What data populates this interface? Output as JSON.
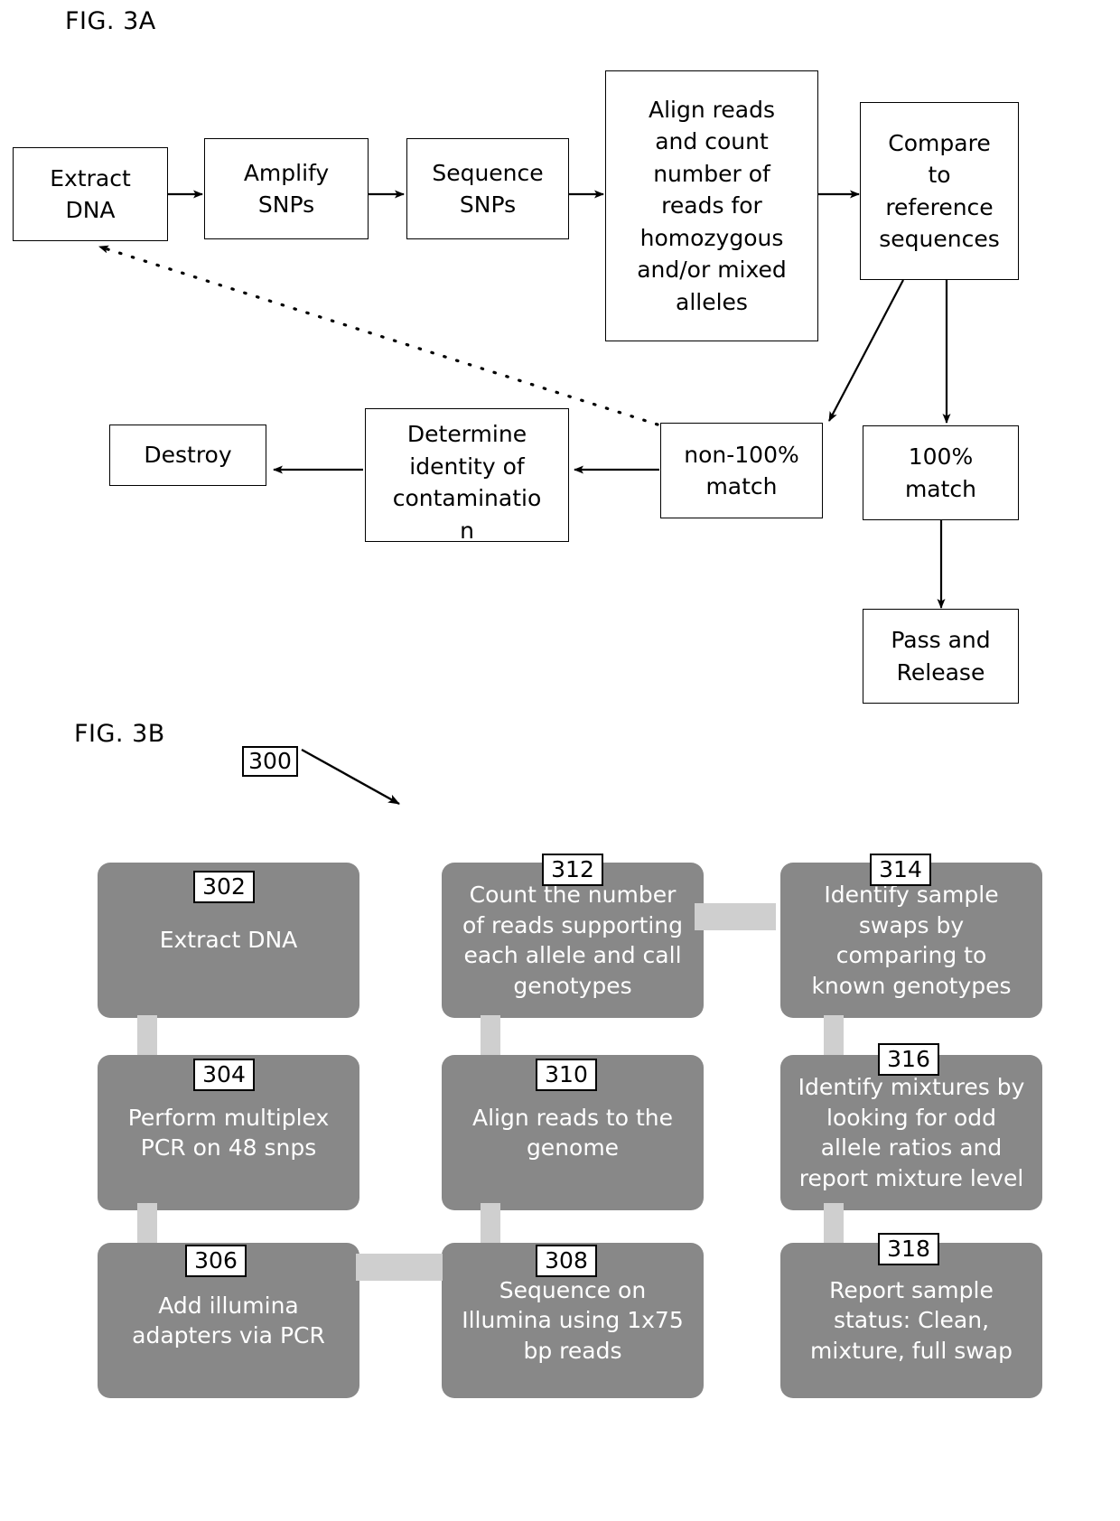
{
  "figures": {
    "fig_a": {
      "caption": "FIG. 3A",
      "boxes": [
        {
          "id": "extract-dna",
          "label": "Extract\nDNA"
        },
        {
          "id": "amplify-snps",
          "label": "Amplify\nSNPs"
        },
        {
          "id": "sequence-snps",
          "label": "Sequence\nSNPs"
        },
        {
          "id": "align-reads",
          "label": "Align reads\nand count\nnumber of\nreads for\nhomozygous\nand/or mixed\nalleles"
        },
        {
          "id": "compare-ref",
          "label": "Compare\nto\nreference\nsequences"
        },
        {
          "id": "non-100-match",
          "label": "non-100%\nmatch"
        },
        {
          "id": "match-100",
          "label": "100%\nmatch"
        },
        {
          "id": "pass-release",
          "label": "Pass and\nRelease"
        },
        {
          "id": "determine-ident",
          "label": "Determine\nidentity of\ncontaminatio\nn"
        },
        {
          "id": "destroy",
          "label": "Destroy"
        }
      ]
    },
    "fig_b": {
      "caption": "FIG. 3B",
      "diagram_ref": "300",
      "boxes": [
        {
          "ref": "302",
          "label": "Extract DNA"
        },
        {
          "ref": "304",
          "label": "Perform multiplex\nPCR on 48 snps"
        },
        {
          "ref": "306",
          "label": "Add illumina\nadapters via PCR"
        },
        {
          "ref": "308",
          "label": "Sequence on\nIllumina using 1x75\nbp reads"
        },
        {
          "ref": "310",
          "label": "Align reads to the\ngenome"
        },
        {
          "ref": "312",
          "label": "Count the number\nof reads supporting\neach allele and call\ngenotypes"
        },
        {
          "ref": "314",
          "label": "Identify sample\nswaps by\ncomparing to\nknown genotypes"
        },
        {
          "ref": "316",
          "label": "Identify mixtures by\nlooking for odd\nallele ratios and\nreport mixture level"
        },
        {
          "ref": "318",
          "label": "Report sample\nstatus: Clean,\nmixture, full swap"
        }
      ]
    }
  },
  "colors": {
    "box_fill": "#888888",
    "box_text": "#ffffff",
    "connector": "#cfcfcf",
    "line": "#000000",
    "page": "#ffffff"
  }
}
